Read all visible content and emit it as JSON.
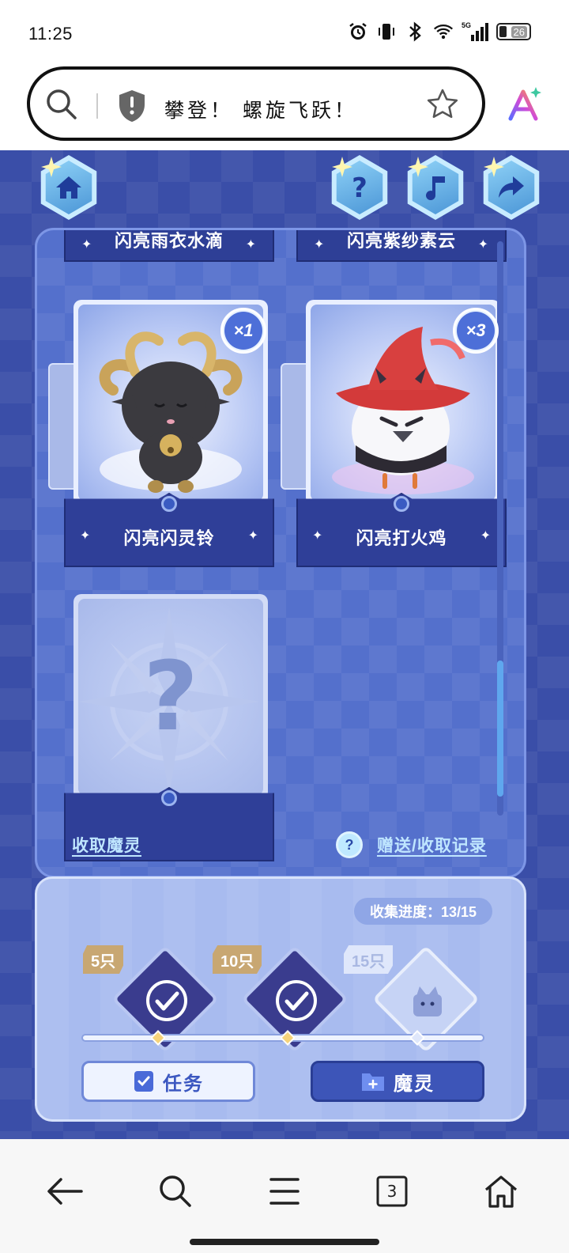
{
  "status_bar": {
    "time": "11:25",
    "battery": "26",
    "network": "5G"
  },
  "address_bar": {
    "title": "攀登！ 螺旋飞跃！"
  },
  "top_buttons": [
    "home-icon",
    "help-icon",
    "music-icon",
    "share-icon"
  ],
  "cards_row_top": [
    {
      "name": "闪亮雨衣水滴"
    },
    {
      "name": "闪亮紫纱素云"
    }
  ],
  "cards": [
    {
      "name": "闪亮闪灵铃",
      "count": "×1"
    },
    {
      "name": "闪亮打火鸡",
      "count": "×3"
    }
  ],
  "mystery_card": {
    "symbol": "?"
  },
  "links": {
    "collect_spirit": "收取魔灵",
    "gift_record": "赠送/收取记录",
    "help": "?"
  },
  "collection": {
    "progress_label": "收集进度：13/15",
    "progress_value": 13,
    "progress_total": 15,
    "rewards": [
      {
        "tag": "5只",
        "claimed": true
      },
      {
        "tag": "10只",
        "claimed": true
      },
      {
        "tag": "15只",
        "claimed": false
      }
    ]
  },
  "buttons": {
    "task": "任务",
    "spirit": "魔灵"
  },
  "bottom_nav": {
    "tab_count": "3"
  },
  "colors": {
    "game_bg": "#3a4ea8",
    "panel": "#5470cc",
    "accent_link": "#bfe6ff"
  }
}
